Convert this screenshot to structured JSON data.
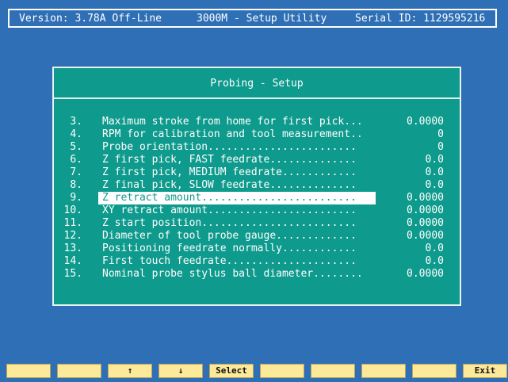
{
  "header": {
    "version": "Version: 3.78A Off-Line",
    "title": "3000M - Setup Utility",
    "serial": "Serial ID: 1129595216"
  },
  "dialog": {
    "title": "Probing - Setup",
    "items": [
      {
        "num": "3.",
        "label": "Maximum stroke from home for first pick...",
        "value": "0.0000"
      },
      {
        "num": "4.",
        "label": "RPM for calibration and tool measurement..",
        "value": "0"
      },
      {
        "num": "5.",
        "label": "Probe orientation........................",
        "value": "0"
      },
      {
        "num": "6.",
        "label": "Z first pick, FAST feedrate..............",
        "value": "0.0"
      },
      {
        "num": "7.",
        "label": "Z first pick, MEDIUM feedrate............",
        "value": "0.0"
      },
      {
        "num": "8.",
        "label": "Z final pick, SLOW feedrate..............",
        "value": "0.0"
      },
      {
        "num": "9.",
        "label": "Z retract amount.........................",
        "value": "0.0000",
        "selected": true
      },
      {
        "num": "10.",
        "label": "XY retract amount........................",
        "value": "0.0000"
      },
      {
        "num": "11.",
        "label": "Z start position.........................",
        "value": "0.0000"
      },
      {
        "num": "12.",
        "label": "Diameter of tool probe gauge.............",
        "value": "0.0000"
      },
      {
        "num": "13.",
        "label": "Positioning feedrate normally............",
        "value": "0.0"
      },
      {
        "num": "14.",
        "label": "First touch feedrate.....................",
        "value": "0.0"
      },
      {
        "num": "15.",
        "label": "Nominal probe stylus ball diameter........",
        "value": "0.0000"
      }
    ]
  },
  "fkeys": [
    {
      "label": ""
    },
    {
      "label": ""
    },
    {
      "label": "↑"
    },
    {
      "label": "↓"
    },
    {
      "label": "Select"
    },
    {
      "label": ""
    },
    {
      "label": ""
    },
    {
      "label": ""
    },
    {
      "label": ""
    },
    {
      "label": "Exit"
    }
  ]
}
